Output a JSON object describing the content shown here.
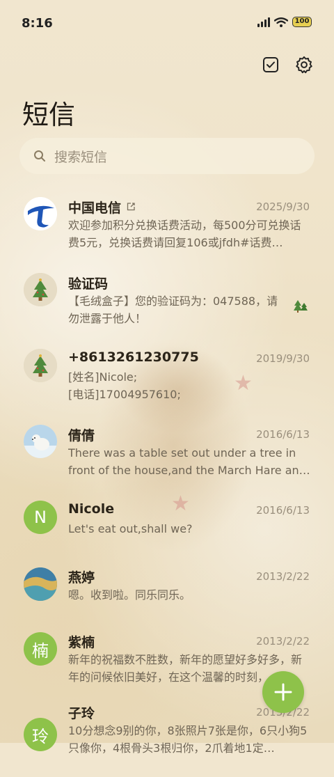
{
  "status": {
    "time": "8:16",
    "battery": "100"
  },
  "header": {
    "title": "短信",
    "icons": [
      "checkbox-icon",
      "gear-icon"
    ]
  },
  "search": {
    "placeholder": "搜索短信"
  },
  "conversations": [
    {
      "name": "中国电信",
      "date": "2025/9/30",
      "preview": "欢迎参加积分兑换话费活动，每500分可兑换话费5元，兑换话费请回复106或jfdh#话费…",
      "avatar_color": "#1f56b7",
      "avatar_text": ""
    },
    {
      "name": "验证码",
      "date": "",
      "preview": "【毛绒盒子】您的验证码为：047588，请勿泄露于他人！",
      "avatar_color": "#cbbf9e",
      "avatar_text": ""
    },
    {
      "name": "+8613261230775",
      "date": "2019/9/30",
      "preview": "[姓名]Nicole;\n[电话]17004957610;",
      "avatar_color": "#cbbf9e",
      "avatar_text": ""
    },
    {
      "name": "倩倩",
      "date": "2016/6/13",
      "preview": "There was a table set out under a tree in front of the house,and the March Hare an…",
      "avatar_color": "#cfe3f0",
      "avatar_text": ""
    },
    {
      "name": "Nicole",
      "date": "2016/6/13",
      "preview": "Let's eat out,shall we?",
      "avatar_color": "#8ec24a",
      "avatar_text": "N"
    },
    {
      "name": "燕婷",
      "date": "2013/2/22",
      "preview": "嗯。收到啦。同乐同乐。",
      "avatar_color": "#4a8fa8",
      "avatar_text": ""
    },
    {
      "name": "紫楠",
      "date": "2013/2/22",
      "preview": "新年的祝福数不胜数，新年的愿望好多好多，新年的问候依旧美好，在这个温馨的时刻，…",
      "avatar_color": "#8ec24a",
      "avatar_text": "楠"
    },
    {
      "name": "子玲",
      "date": "2013/2/22",
      "preview": "10分想念9别的你，8张照片7张是你，6只小狗5只像你，4根骨头3根归你，2爪着地1定…",
      "avatar_color": "#8ec24a",
      "avatar_text": "玲"
    }
  ],
  "fab": {
    "icon": "plus-icon"
  }
}
